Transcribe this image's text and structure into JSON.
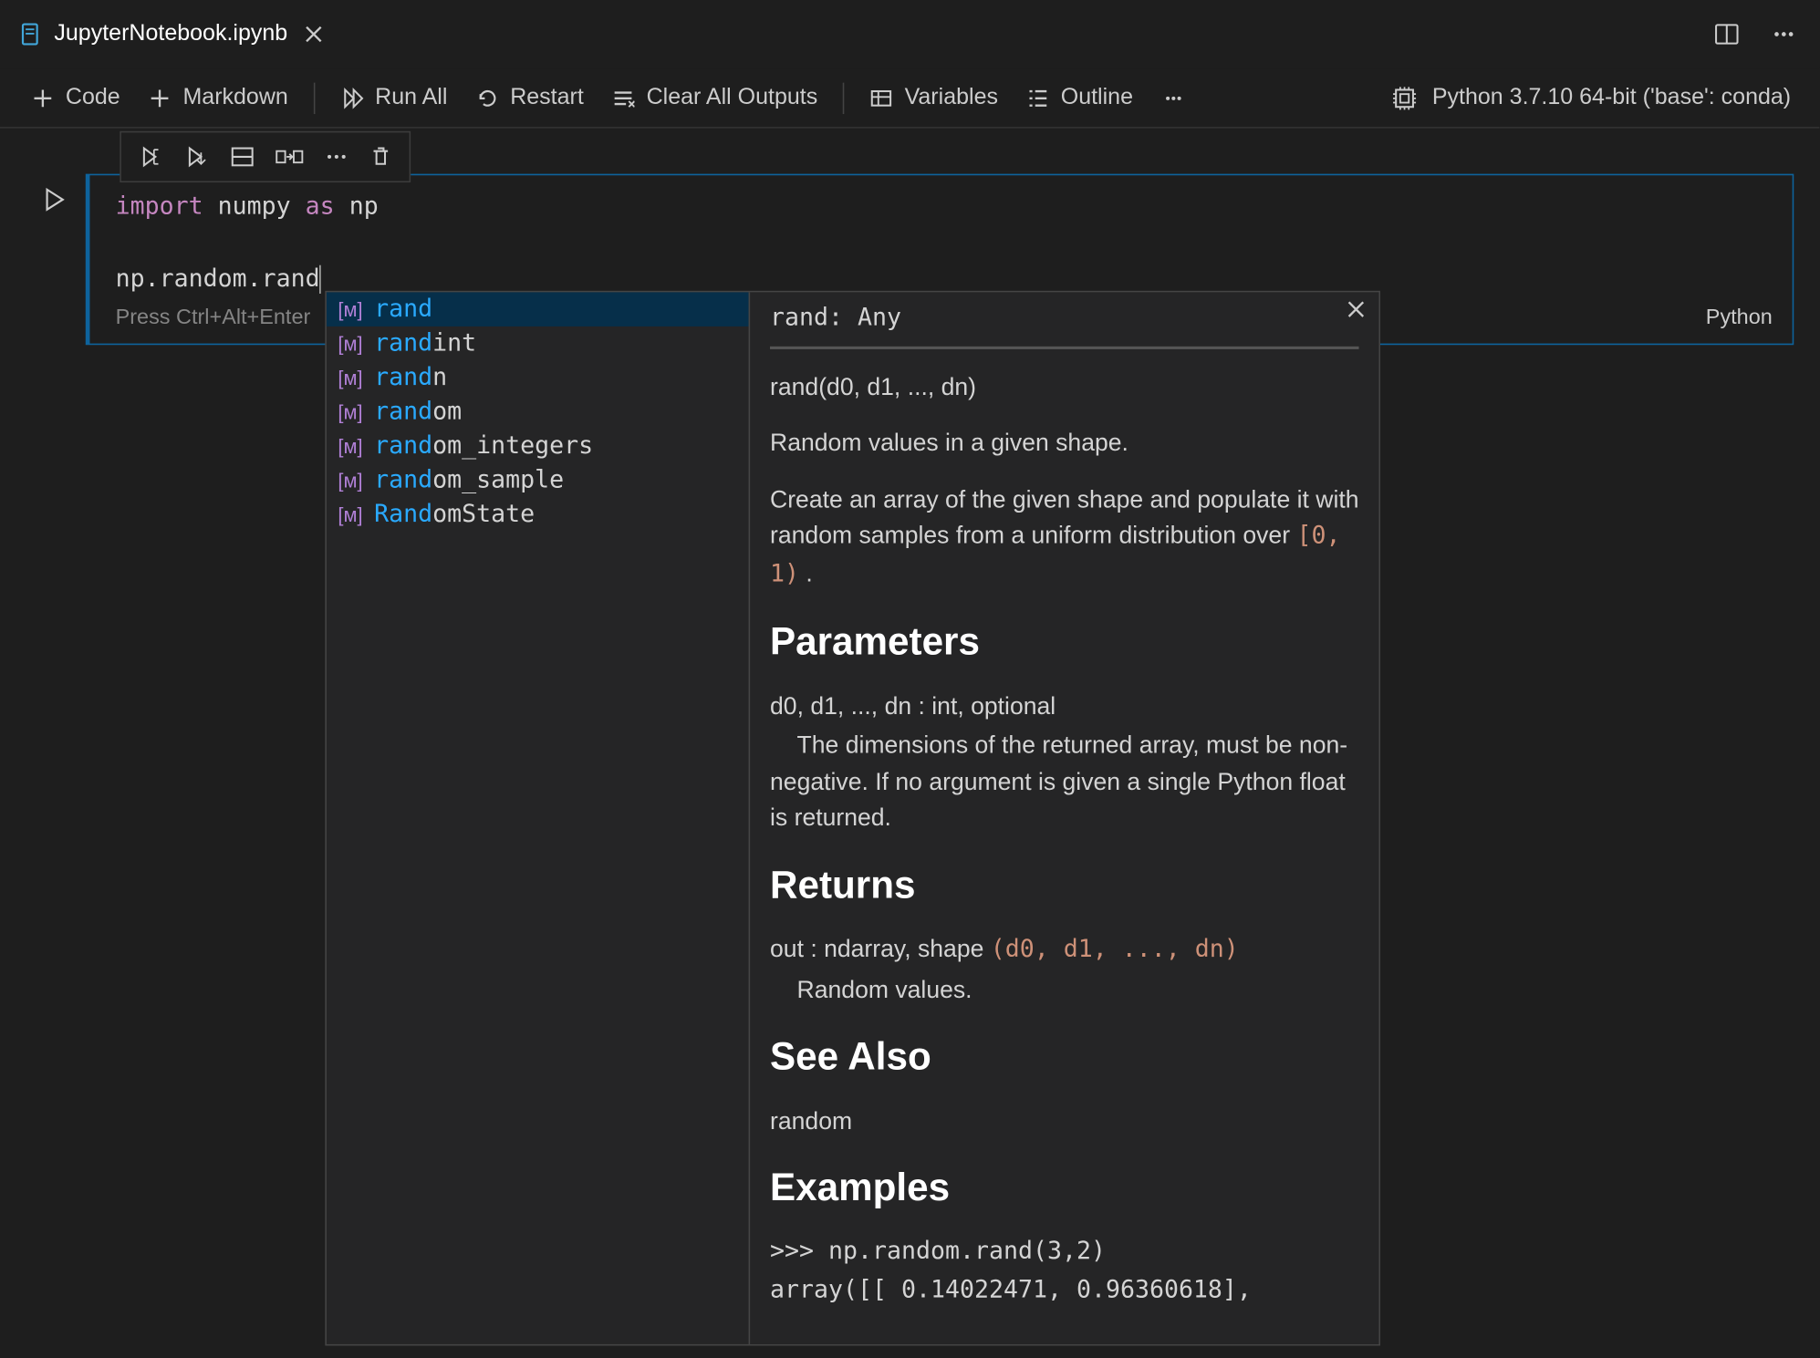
{
  "tab": {
    "filename": "JupyterNotebook.ipynb"
  },
  "toolbar": {
    "code": "Code",
    "markdown": "Markdown",
    "run_all": "Run All",
    "restart": "Restart",
    "clear_all": "Clear All Outputs",
    "variables": "Variables",
    "outline": "Outline"
  },
  "kernel": {
    "label": "Python 3.7.10 64-bit ('base': conda)"
  },
  "cell": {
    "line1_kw": "import",
    "line1_mod": "numpy",
    "line1_as": "as",
    "line1_alias": "np",
    "line2": "np.random.rand",
    "hint": "Press Ctrl+Alt+Enter",
    "language": "Python"
  },
  "suggest": {
    "items": [
      {
        "match": "rand",
        "rest": ""
      },
      {
        "match": "rand",
        "rest": "int"
      },
      {
        "match": "rand",
        "rest": "n"
      },
      {
        "match": "rand",
        "rest": "om"
      },
      {
        "match": "rand",
        "rest": "om_integers"
      },
      {
        "match": "rand",
        "rest": "om_sample"
      },
      {
        "match": "Rand",
        "rest": "omState"
      }
    ],
    "doc": {
      "signature": "rand: Any",
      "call": "rand(d0, d1, ..., dn)",
      "summary": "Random values in a given shape.",
      "desc_pre": "Create an array of the given shape and populate it with random samples from a uniform distribution over ",
      "desc_code": "[0, 1)",
      "desc_post": " .",
      "h_params": "Parameters",
      "params_line1": "d0, d1, ..., dn : int, optional",
      "params_line2": "    The dimensions of the returned array, must be non-negative. If no argument is given a single Python float is returned.",
      "h_returns": "Returns",
      "returns_pre": "out : ndarray, shape ",
      "returns_code": "(d0, d1, ..., dn)",
      "returns_line2": "    Random values.",
      "h_seealso": "See Also",
      "seealso": "random",
      "h_examples": "Examples",
      "ex_line1": ">>> np.random.rand(3,2)",
      "ex_line2": "array([[ 0.14022471,  0.96360618],"
    }
  }
}
